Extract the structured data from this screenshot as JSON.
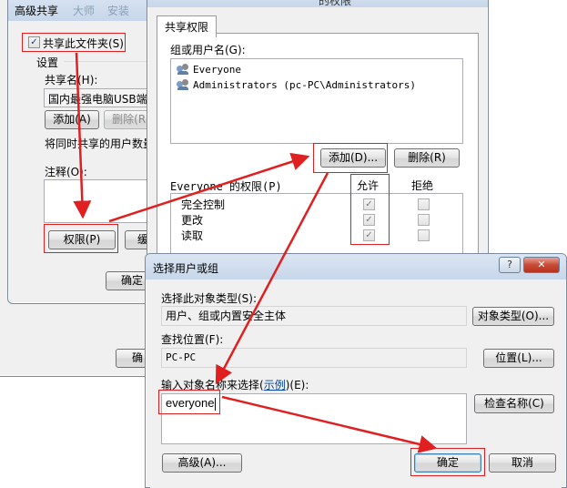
{
  "adv_share": {
    "title": "高级共享",
    "title_tab2": "大师",
    "title_tab3": "安装",
    "share_checkbox_label": "共享此文件夹(S)",
    "share_checked": true,
    "settings_label": "设置",
    "share_name_label": "共享名(H):",
    "share_name_value": "国内最强电脑USB端口",
    "add_label": "添加(A)",
    "remove_label": "删除(R)",
    "limit_text": "将同时共享的用户数量",
    "comment_label": "注释(O):",
    "permissions_label": "权限(P)",
    "caching_label": "缓",
    "ok_label": "确定",
    "ok_label_back": "确"
  },
  "perm_dialog": {
    "title": "的权限",
    "tab_label": "共享权限",
    "group_label": "组或用户名(G):",
    "users": [
      {
        "name": "Everyone"
      },
      {
        "name": "Administrators (pc-PC\\Administrators)"
      }
    ],
    "add_label": "添加(D)...",
    "remove_label": "删除(R)",
    "perm_header": "Everyone 的权限(P)",
    "allow_header": "允许",
    "deny_header": "拒绝",
    "permissions": [
      {
        "name": "完全控制",
        "allow": true,
        "deny": false
      },
      {
        "name": "更改",
        "allow": true,
        "deny": false
      },
      {
        "name": "读取",
        "allow": true,
        "deny": false
      }
    ]
  },
  "select_dialog": {
    "title": "选择用户或组",
    "help_icon": "?",
    "close_icon": "✕",
    "object_type_label": "选择此对象类型(S):",
    "object_type_value": "用户、组或内置安全主体",
    "object_type_button": "对象类型(O)...",
    "location_label": "查找位置(F):",
    "location_value": "PC-PC",
    "location_button": "位置(L)...",
    "enter_label_prefix": "输入对象名称来选择(",
    "enter_label_link": "示例",
    "enter_label_suffix": ")(E):",
    "enter_value": "everyone",
    "check_names_button": "检查名称(C)",
    "advanced_button": "高级(A)...",
    "ok_button": "确定",
    "cancel_button": "取消"
  },
  "colors": {
    "annotation": "#e02020",
    "link": "#0645ad"
  }
}
